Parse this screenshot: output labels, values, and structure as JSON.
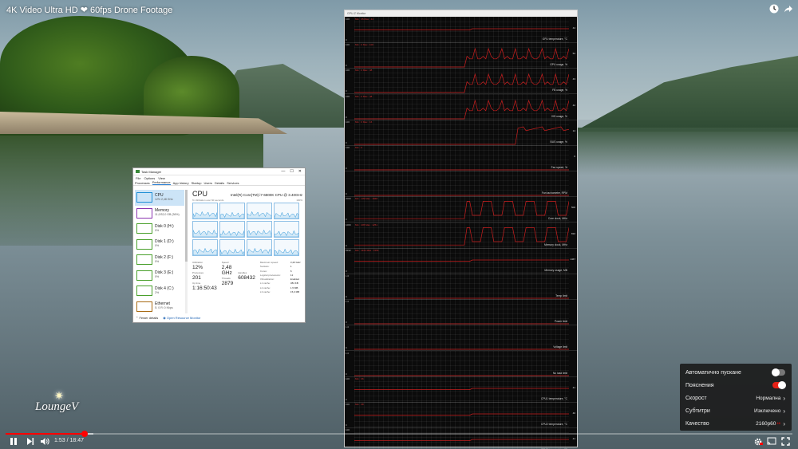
{
  "video": {
    "title": "4K Video Ultra HD ❤ 60fps Drone Footage",
    "current_time": "1:53",
    "duration": "18:47",
    "time_separator": "/",
    "progress_fraction": 0.1003,
    "buffered_fraction": 0.112,
    "logo_text": "LoungeV"
  },
  "colors": {
    "accent_red": "#ff0000",
    "monitor_line": "#c81e1e",
    "tm_cpu_blue": "#1f8fd6"
  },
  "icons": {
    "clock": "clock-icon",
    "share": "share-icon",
    "play_pause": "pause-icon",
    "next": "next-icon",
    "volume": "volume-icon",
    "settings": "gear-icon",
    "cast": "cast-icon",
    "fullscreen": "fullscreen-icon"
  },
  "settings_menu": {
    "autoplay_label": "Автоматично пускане",
    "autoplay_on": false,
    "annotations_label": "Пояснения",
    "annotations_on": true,
    "speed_label": "Скорост",
    "speed_value": "Нормална",
    "subtitles_label": "Субтитри",
    "subtitles_value": "Изключено",
    "quality_label": "Качество",
    "quality_value": "2160p60",
    "quality_badge": "4K"
  },
  "task_manager": {
    "window_title": "Task Manager",
    "menu": [
      "File",
      "Options",
      "View"
    ],
    "tabs": [
      "Processes",
      "Performance",
      "App history",
      "Startup",
      "Users",
      "Details",
      "Services"
    ],
    "active_tab": "Performance",
    "sidebar": [
      {
        "name": "CPU",
        "sub": "12%  2,48 GHz",
        "color": "#1f8fd6"
      },
      {
        "name": "Memory",
        "sub": "11,0/32,0 GB (36%)",
        "color": "#8b35b0"
      },
      {
        "name": "Disk 0 (H:)",
        "sub": "0%",
        "color": "#4aa02c"
      },
      {
        "name": "Disk 1 (D:)",
        "sub": "0%",
        "color": "#4aa02c"
      },
      {
        "name": "Disk 2 (F:)",
        "sub": "0%",
        "color": "#4aa02c"
      },
      {
        "name": "Disk 3 (E:)",
        "sub": "0%",
        "color": "#4aa02c"
      },
      {
        "name": "Disk 4 (C:)",
        "sub": "2%",
        "color": "#4aa02c"
      },
      {
        "name": "Ethernet",
        "sub": "S: 0  R: 0 Kbps",
        "color": "#a76a14"
      }
    ],
    "cpu_title": "CPU",
    "cpu_model": "Intel(R) Core(TM) i7-6800K CPU @ 3.40GHz",
    "graph_caption_left": "% Utilization over 60 seconds",
    "graph_caption_right": "100%",
    "utilization_label": "Utilization",
    "utilization": "12%",
    "speed_label": "Speed",
    "speed": "2,48 GHz",
    "processes_label": "Processes",
    "processes": "201",
    "threads_label": "Threads",
    "threads": "2879",
    "handles_label": "Handles",
    "handles": "608432",
    "uptime_label": "Up time",
    "uptime": "1:16:50:43",
    "specs": [
      {
        "k": "Maximum speed:",
        "v": "3,40 GHz"
      },
      {
        "k": "Sockets:",
        "v": "1"
      },
      {
        "k": "Cores:",
        "v": "6"
      },
      {
        "k": "Logical processors:",
        "v": "12"
      },
      {
        "k": "Virtualization:",
        "v": "Enabled"
      },
      {
        "k": "L1 cache:",
        "v": "384 KB"
      },
      {
        "k": "L2 cache:",
        "v": "1,5 MB"
      },
      {
        "k": "L3 cache:",
        "v": "15,0 MB"
      }
    ],
    "fewer_details": "Fewer details",
    "open_resource_monitor": "Open Resource Monitor"
  },
  "monitor": {
    "window_title": "GPU-Z Monitor",
    "rows": [
      {
        "label": "GPU temperature, °C",
        "top": "100",
        "bottom": "0",
        "value": "44",
        "mini": "Min : 35   Max : 44",
        "shape": "flat"
      },
      {
        "label": "GPU usage, %",
        "top": "100",
        "bottom": "0",
        "value": "52",
        "mini": "Min : 0   Max : 100",
        "shape": "spiky"
      },
      {
        "label": "FB usage, %",
        "top": "100",
        "bottom": "0",
        "value": "43",
        "mini": "Min : 0   Max : 48",
        "shape": "spiky"
      },
      {
        "label": "VID usage, %",
        "top": "100",
        "bottom": "0",
        "value": "42",
        "mini": "Min : 0   Max : 48",
        "shape": "spiky"
      },
      {
        "label": "BUS usage, %",
        "top": "100",
        "bottom": "0",
        "value": "14",
        "mini": "Min : 0   Max : 16",
        "shape": "rise"
      },
      {
        "label": "Fan speed, %",
        "top": "100",
        "bottom": "0",
        "value": "0",
        "mini": "Min : 0",
        "shape": "zero"
      },
      {
        "label": "Fan tachometer, RPM",
        "top": "",
        "bottom": "0",
        "value": "",
        "mini": "",
        "shape": "zero"
      },
      {
        "label": "Core clock, MHz",
        "top": "2000",
        "bottom": "0",
        "value": "500",
        "mini": "Min : 139   Max : 1848",
        "shape": "square"
      },
      {
        "label": "Memory clock, MHz",
        "top": "1000",
        "bottom": "0",
        "value": "810",
        "mini": "Min : 405   Max : 1251",
        "shape": "square"
      },
      {
        "label": "Memory usage, MB",
        "top": "8192",
        "bottom": "0",
        "value": "1467",
        "mini": "Min : 1162   Max : 1556",
        "shape": "flat"
      },
      {
        "label": "Temp limit",
        "top": "1.0",
        "bottom": "0",
        "value": "",
        "mini": "",
        "shape": "zero"
      },
      {
        "label": "Power limit",
        "top": "1.0",
        "bottom": "0",
        "value": "",
        "mini": "",
        "shape": "zero"
      },
      {
        "label": "Voltage limit",
        "top": "1.0",
        "bottom": "0",
        "value": "",
        "mini": "",
        "shape": "zero"
      },
      {
        "label": "No load limit",
        "top": "1.0",
        "bottom": "0",
        "value": "",
        "mini": "",
        "shape": "zero"
      },
      {
        "label": "CPU1 temperature, °C",
        "top": "100",
        "bottom": "0",
        "value": "41",
        "mini": "Min : 36",
        "shape": "flat"
      },
      {
        "label": "CPU2 temperature, °C",
        "top": "100",
        "bottom": "0",
        "value": "40",
        "mini": "Min : 38",
        "shape": "flat"
      },
      {
        "label": "CPU3 temperature, °C",
        "top": "100",
        "bottom": "0",
        "value": "41",
        "mini": "",
        "shape": "flat"
      }
    ]
  }
}
